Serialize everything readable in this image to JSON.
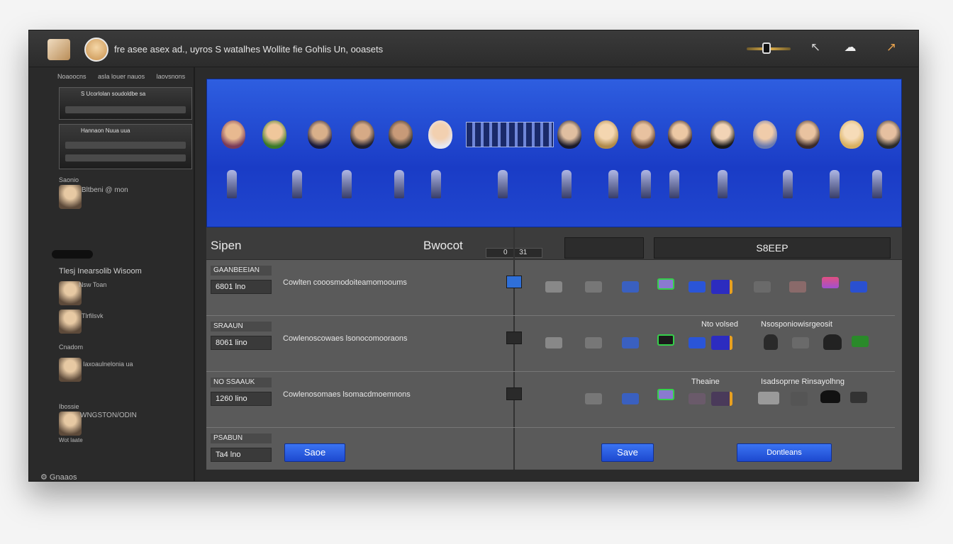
{
  "titlebar": {
    "title": "fre asee asex ad., uyros S watalhes Wollite fie Gohlis Un, ooasets"
  },
  "sidebar": {
    "tabs": [
      "Noaoocns",
      "asla louer nauos",
      "laovsnons"
    ],
    "cards": [
      {
        "label": "S Ucorlolan soudoldbe sa"
      },
      {
        "label": "Hannaon Nuua uua"
      }
    ],
    "item1_small": "Saonio",
    "item1_label": "Bltbeni @ mon",
    "section": "Tlesj Inearsolib Wisoom",
    "item2_label": "Nsw Toan",
    "item3_label": "Tlrfilsvk",
    "item4_small": "Cnadom",
    "item4_label": "Iaxoaulnelonia ua",
    "item5_small": "Ibossie",
    "item5_label": "WNGSTON/ODIN",
    "item5_sub": "Wot laate",
    "footer": "Gnaaos"
  },
  "panel": {
    "header_left": "Sipen",
    "header_mid": "Bwocot",
    "header_small_left": "0",
    "header_small_right": "31",
    "header_button": "S8EEP",
    "rows": [
      {
        "tag": "GAANBEEIAN",
        "value": "6801 lno",
        "desc": "Cowlten cooosmodoiteamomooums"
      },
      {
        "tag": "SRAAUN",
        "value": "8061 lino",
        "desc": "Cowlenoscowaes lsonocomooraons",
        "note1": "Nto volsed",
        "note2": "Nsosponiowisrgeosit"
      },
      {
        "tag": "NO SSAAUK",
        "value": "1260 lino",
        "desc": "Cowlenosomaes lsomacdmoemnons",
        "note1": "Theaine",
        "note2": "Isadsoprne Rinsayolhng"
      },
      {
        "tag": "PSABUN",
        "value": "Ta4 lno"
      }
    ],
    "save_left": "Saoe",
    "save_mid": "Save",
    "button_right": "Dontleans"
  }
}
